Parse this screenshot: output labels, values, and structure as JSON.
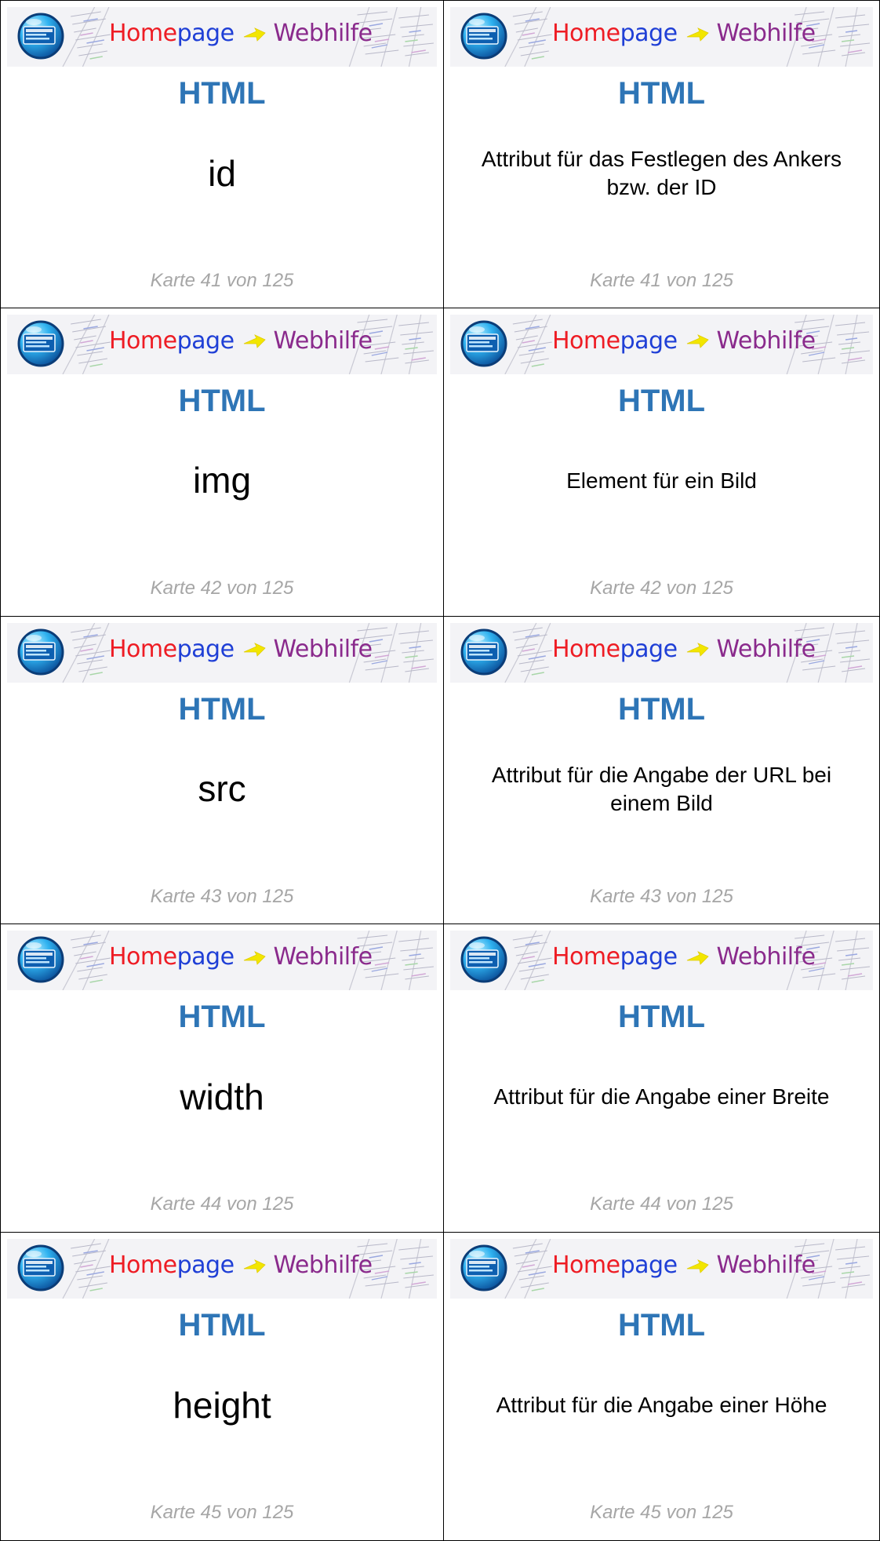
{
  "brand": {
    "home": "Home",
    "page": "page",
    "web": "Webhilfe",
    "colors": {
      "home": "#ee1c24",
      "page": "#1f3fd6",
      "web": "#8a2a8c",
      "arrow": "#f2e600",
      "subject": "#2e75b6",
      "counter": "#a6a6a6"
    },
    "icons": [
      "globe-logo-icon",
      "yellow-arrow-icon"
    ]
  },
  "cards": [
    {
      "subject": "HTML",
      "term": "id",
      "definition": "Attribut für das Festlegen des Ankers bzw. der ID",
      "counter": "Karte 41 von 125"
    },
    {
      "subject": "HTML",
      "term": "img",
      "definition": "Element für ein Bild",
      "counter": "Karte 42 von 125"
    },
    {
      "subject": "HTML",
      "term": "src",
      "definition": "Attribut für die Angabe der URL bei einem Bild",
      "counter": "Karte 43 von 125"
    },
    {
      "subject": "HTML",
      "term": "width",
      "definition": "Attribut für die Angabe einer Breite",
      "counter": "Karte 44 von 125"
    },
    {
      "subject": "HTML",
      "term": "height",
      "definition": "Attribut für die Angabe einer Höhe",
      "counter": "Karte 45 von 125"
    }
  ]
}
